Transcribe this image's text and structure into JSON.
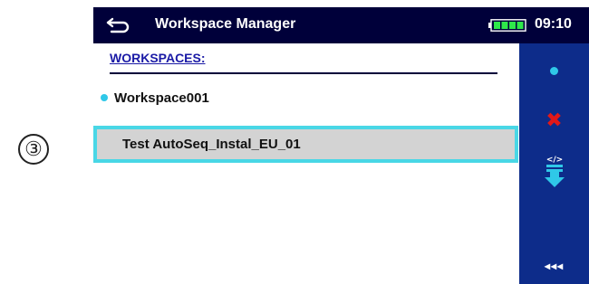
{
  "step_marker": "③",
  "titlebar": {
    "title": "Workspace Manager",
    "clock": "09:10",
    "back_icon": "back-arrow-icon",
    "battery_icon": "battery-icon"
  },
  "workspaces": {
    "header": "WORKSPACES:",
    "items": [
      {
        "label": "Workspace001",
        "state": "active"
      },
      {
        "label": "Test AutoSeq_Instal_EU_01",
        "state": "selected"
      }
    ]
  },
  "sidebar": {
    "buttons": [
      {
        "icon": "open-dot-icon"
      },
      {
        "icon": "delete-x-icon"
      },
      {
        "icon": "import-download-icon"
      },
      {
        "icon": "more-options-icon",
        "label": "◂◂◂"
      }
    ]
  },
  "colors": {
    "title_bar": "#00003a",
    "side_bar": "#0d2c8a",
    "accent_cyan": "#2fc8e8",
    "selection_border": "#49d7e6",
    "delete_red": "#e21818"
  }
}
